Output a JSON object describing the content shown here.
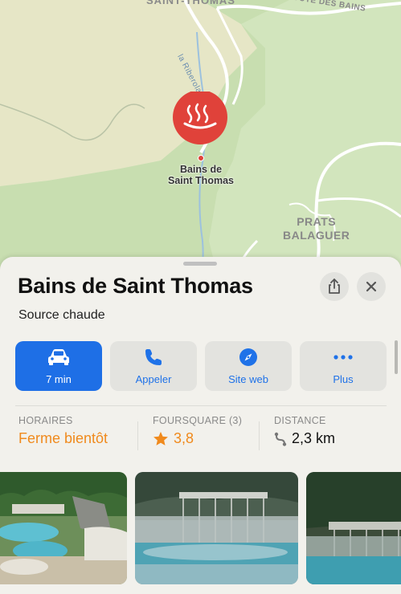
{
  "map": {
    "top_label": "SAINT-THOMAS",
    "route_label": "ROUTE DES BAINS",
    "river_label": "la Riberola",
    "place_label_line1": "PRATS",
    "place_label_line2": "BALAGUER",
    "pin_label_line1": "Bains de",
    "pin_label_line2": "Saint Thomas",
    "pin_color": "#e0423a"
  },
  "place": {
    "title": "Bains de Saint Thomas",
    "category": "Source chaude"
  },
  "actions": [
    {
      "label": "7 min",
      "icon": "car-icon"
    },
    {
      "label": "Appeler",
      "icon": "phone-icon"
    },
    {
      "label": "Site web",
      "icon": "compass-icon"
    },
    {
      "label": "Plus",
      "icon": "more-icon"
    }
  ],
  "info": {
    "hours_header": "HORAIRES",
    "hours_value": "Ferme bientôt",
    "rating_header": "FOURSQUARE (3)",
    "rating_value": "3,8",
    "distance_header": "DISTANCE",
    "distance_value": "2,3 km"
  },
  "colors": {
    "accent": "#1e6fe6",
    "warning": "#f08a1d"
  }
}
